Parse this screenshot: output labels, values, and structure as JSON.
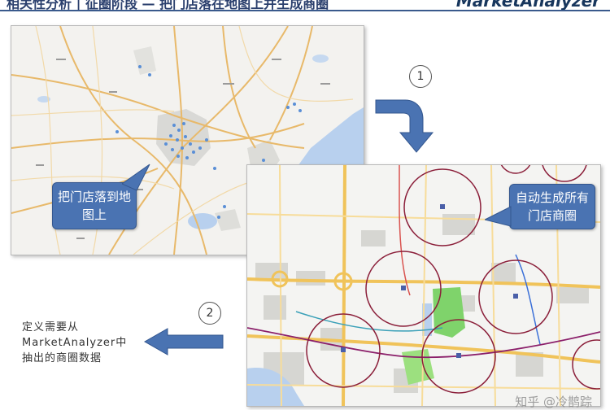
{
  "header": {
    "title": "相关性分析 | 征圈阶段 — 把门店落在地图上并生成商圈",
    "brand": "MarketAnalyzer"
  },
  "map_top": {
    "callout": "把门店落到地\n图上"
  },
  "map_bottom": {
    "callout": "自动生成所有\n门店商圈"
  },
  "steps": {
    "step1": "1",
    "step2": "2"
  },
  "side_note": {
    "line1": "定义需要从",
    "line2": "MarketAnalyzer中",
    "line3": "抽出的商圈数据"
  },
  "watermark": "知乎 @冷鹊踪",
  "colors": {
    "accent_blue": "#4a73b2",
    "circle_outline": "#8b1f3a",
    "water": "#b8d0ee",
    "park": "#7fd36b"
  }
}
